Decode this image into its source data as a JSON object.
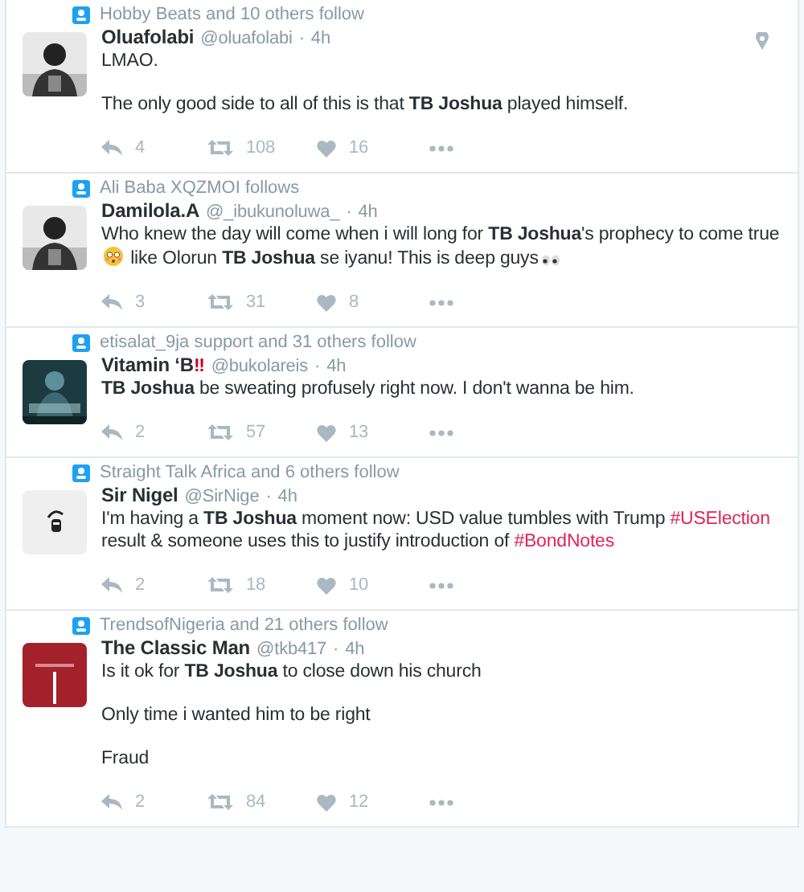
{
  "tweets": [
    {
      "context": "Hobby Beats and 10 others follow",
      "name": "Oluafolabi",
      "handle": "@oluafolabi",
      "separator": "·",
      "time": "4h",
      "has_location": true,
      "avatar": {
        "kind": "portrait"
      },
      "paragraphs": [
        [
          {
            "kind": "text",
            "text": "LMAO."
          }
        ],
        [
          {
            "kind": "text",
            "text": "The only good side to all of this is that **TB Joshua** played himself."
          }
        ]
      ],
      "actions": {
        "replies": "4",
        "retweets": "108",
        "likes": "16"
      }
    },
    {
      "context": "Ali Baba XQZMOI follows",
      "name": "Damilola.A",
      "handle": "@_ibukunoluwa_",
      "separator": "·",
      "time": "4h",
      "has_location": false,
      "avatar": {
        "kind": "portrait"
      },
      "paragraphs": [
        [
          {
            "kind": "text",
            "text": "Who knew the day will come when i will long for **TB Joshua**'s prophecy to come true"
          },
          {
            "kind": "face-emoji"
          },
          {
            "kind": "text",
            "text": " like Olorun **TB Joshua** se iyanu! This is deep guys"
          },
          {
            "kind": "eyes-emoji"
          }
        ]
      ],
      "actions": {
        "replies": "3",
        "retweets": "31",
        "likes": "8"
      }
    },
    {
      "context": "etisalat_9ja support and 31 others follow",
      "name": "Vitamin ‘B",
      "name_mark": "‼",
      "handle": "@bukolareis",
      "separator": "·",
      "time": "4h",
      "has_location": false,
      "avatar": {
        "kind": "poster"
      },
      "paragraphs": [
        [
          {
            "kind": "text",
            "text": "**TB Joshua** be sweating profusely right now. I don't wanna be him."
          }
        ]
      ],
      "actions": {
        "replies": "2",
        "retweets": "57",
        "likes": "13"
      }
    },
    {
      "context": "Straight Talk Africa and 6 others follow",
      "name": "Sir Nigel",
      "handle": "@SirNige",
      "separator": "·",
      "time": "4h",
      "has_location": false,
      "avatar": {
        "kind": "emblem"
      },
      "paragraphs": [
        [
          {
            "kind": "text",
            "text": "I'm having a **TB Joshua** moment now: USD value tumbles with Trump "
          },
          {
            "kind": "hashtag",
            "text": "#USElection"
          },
          {
            "kind": "text",
            "text": " result & someone uses this to justify introduction of "
          },
          {
            "kind": "hashtag",
            "text": "#BondNotes"
          }
        ]
      ],
      "actions": {
        "replies": "2",
        "retweets": "18",
        "likes": "10"
      }
    },
    {
      "context": "TrendsofNigeria and 21 others follow",
      "name": "The Classic Man",
      "handle": "@tkb417",
      "separator": "·",
      "time": "4h",
      "has_location": false,
      "avatar": {
        "kind": "banner"
      },
      "paragraphs": [
        [
          {
            "kind": "text",
            "text": "Is it ok for **TB Joshua** to close down his church"
          }
        ],
        [
          {
            "kind": "text",
            "text": "Only time i wanted him to be right"
          }
        ],
        [
          {
            "kind": "text",
            "text": "Fraud"
          }
        ]
      ],
      "actions": {
        "replies": "2",
        "retweets": "84",
        "likes": "12"
      }
    }
  ]
}
